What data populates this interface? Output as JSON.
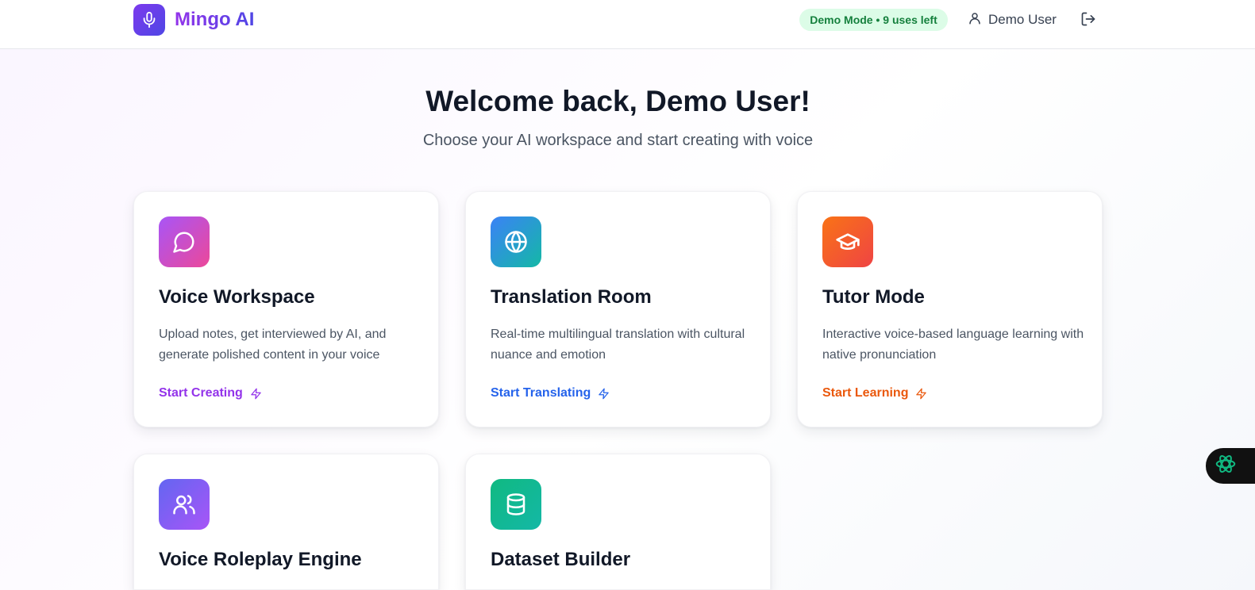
{
  "header": {
    "app_name": "Mingo AI",
    "demo_badge": "Demo Mode • 9 uses left",
    "user_name": "Demo User"
  },
  "hero": {
    "title": "Welcome back, Demo User!",
    "subtitle": "Choose your AI workspace and start creating with voice"
  },
  "cards": [
    {
      "title": "Voice Workspace",
      "description": "Upload notes, get interviewed by AI, and generate polished content in your voice",
      "cta": "Start Creating",
      "icon": "chat-bubble-icon",
      "cta_color": "#9333ea"
    },
    {
      "title": "Translation Room",
      "description": "Real-time multilingual translation with cultural nuance and emotion",
      "cta": "Start Translating",
      "icon": "globe-icon",
      "cta_color": "#2563eb"
    },
    {
      "title": "Tutor Mode",
      "description": "Interactive voice-based language learning with native pronunciation",
      "cta": "Start Learning",
      "icon": "graduation-cap-icon",
      "cta_color": "#ea580c"
    },
    {
      "title": "Voice Roleplay Engine",
      "icon": "users-icon"
    },
    {
      "title": "Dataset Builder",
      "icon": "database-icon"
    }
  ],
  "colors": {
    "brand_gradient": [
      "#7c3aed",
      "#4f46e5"
    ],
    "badge_bg": "#dcfce7",
    "badge_text": "#15803d"
  }
}
